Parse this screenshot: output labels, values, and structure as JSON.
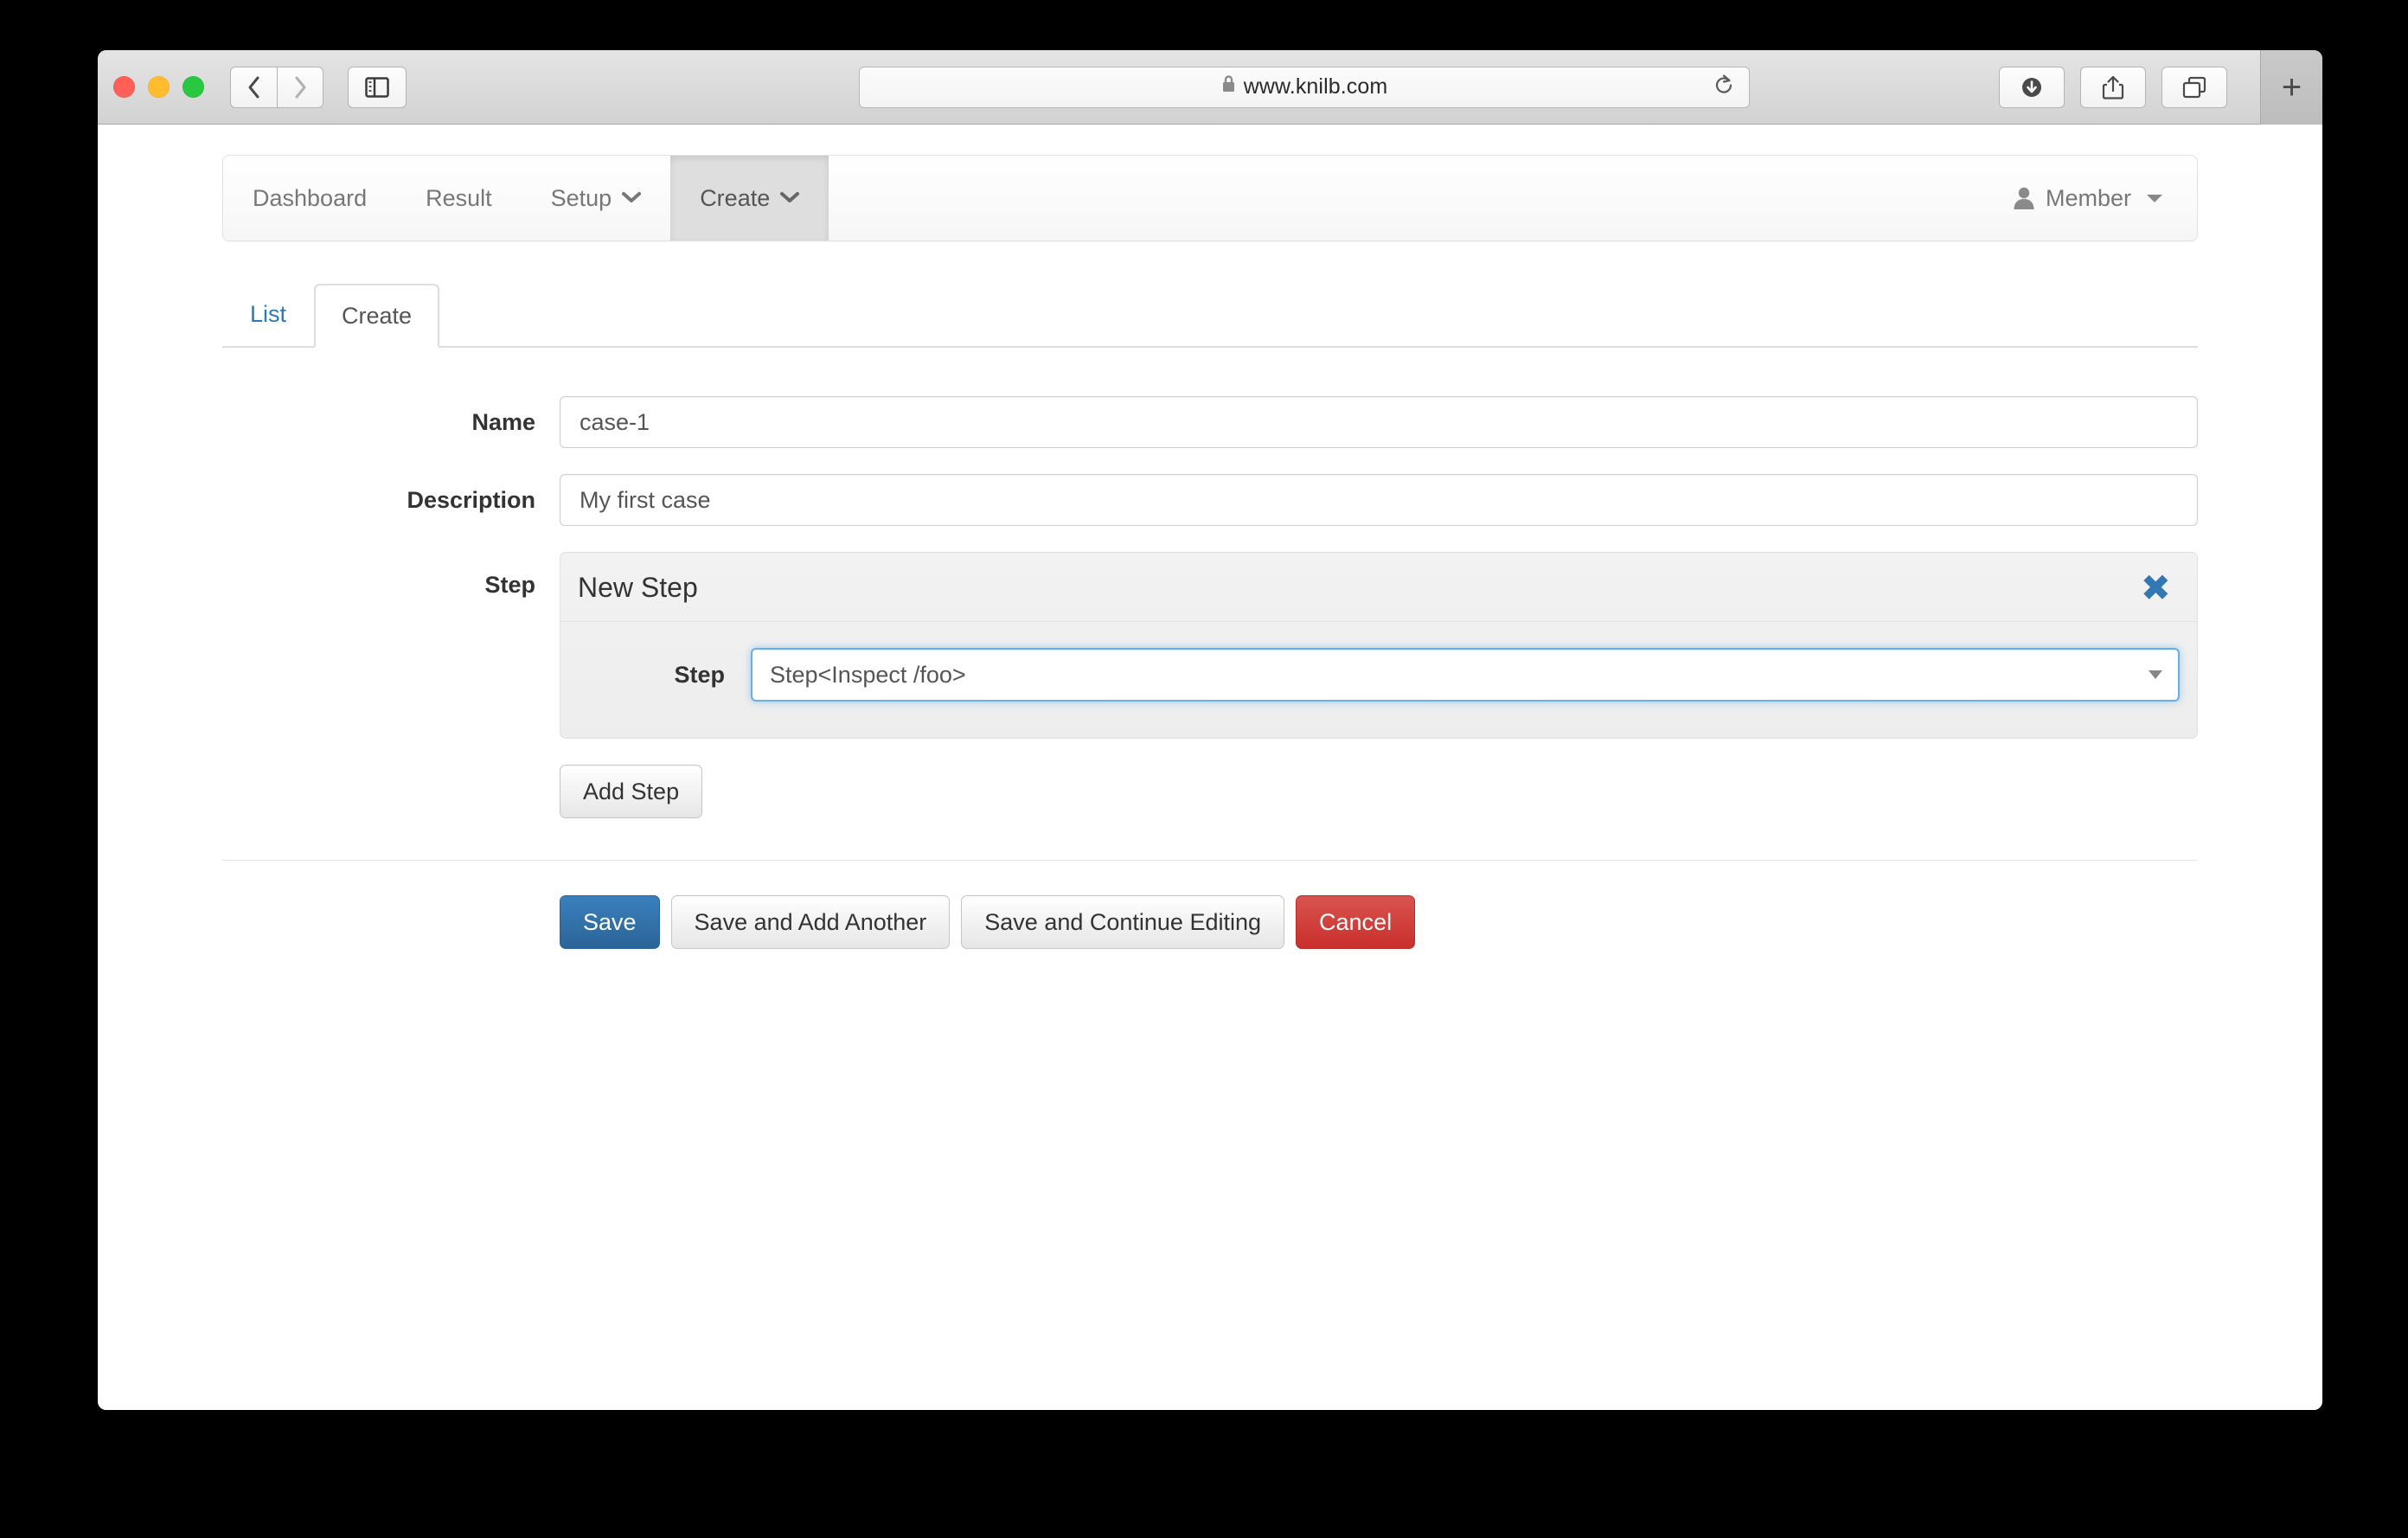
{
  "browser": {
    "url": "www.knilb.com",
    "lock_icon": "lock-icon",
    "reload_icon": "reload-icon",
    "back_icon": "chevron-left-icon",
    "forward_icon": "chevron-right-icon",
    "sidebar_icon": "sidebar-toggle-icon",
    "download_icon": "download-icon",
    "share_icon": "share-icon",
    "tabs_icon": "show-all-tabs-icon",
    "new_tab_label": "+"
  },
  "navbar": {
    "items": [
      {
        "label": "Dashboard",
        "has_caret": false,
        "active": false
      },
      {
        "label": "Result",
        "has_caret": false,
        "active": false
      },
      {
        "label": "Setup",
        "has_caret": true,
        "active": false
      },
      {
        "label": "Create",
        "has_caret": true,
        "active": true
      }
    ],
    "caret_glyph": "⌄",
    "user": {
      "label": "Member",
      "icon": "person-icon"
    }
  },
  "tabs": [
    {
      "label": "List",
      "active": false
    },
    {
      "label": "Create",
      "active": true
    }
  ],
  "form": {
    "name": {
      "label": "Name",
      "value": "case-1",
      "placeholder": "Name"
    },
    "description": {
      "label": "Description",
      "value": "My first case",
      "placeholder": "Description"
    },
    "step": {
      "label": "Step",
      "panel_title": "New Step",
      "close_glyph": "✖",
      "inner_label": "Step",
      "selected_option": "Step<Inspect /foo>",
      "options": [
        "Step<Inspect /foo>"
      ]
    },
    "add_step_label": "Add Step"
  },
  "actions": [
    {
      "label": "Save",
      "style": "primary"
    },
    {
      "label": "Save and Add Another",
      "style": "default"
    },
    {
      "label": "Save and Continue Editing",
      "style": "default"
    },
    {
      "label": "Cancel",
      "style": "danger"
    }
  ],
  "colors": {
    "primary": "#2a6496",
    "danger": "#c9302c",
    "link": "#2a7ab8",
    "focus_border": "#66afe9",
    "close_icon": "#3278b4"
  }
}
